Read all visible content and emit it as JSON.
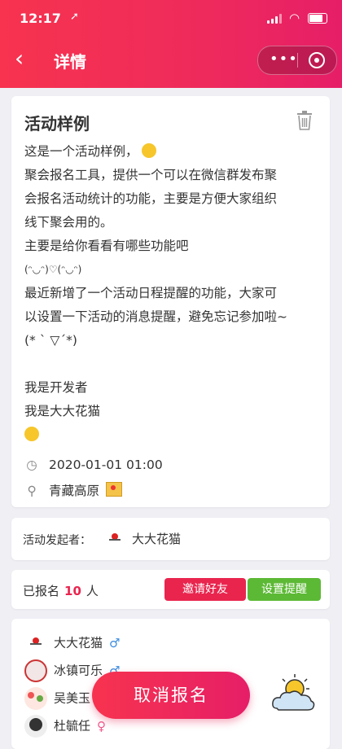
{
  "status": {
    "time": "12:17",
    "location_glyph": "➚"
  },
  "nav": {
    "back_glyph": "‹",
    "title": "详情",
    "more_glyph": "•••"
  },
  "activity": {
    "title": "活动样例",
    "description_lines": [
      "这是一个活动样例，",
      "聚会报名工具，提供一个可以在微信群发布聚",
      "会报名活动统计的功能，主要是方便大家组织",
      "线下聚会用的。",
      "主要是给你看看有哪些功能吧",
      "(ᵔ◡ᵔ)♡(ᵔ◡ᵔ)",
      "最近新增了一个活动日程提醒的功能，大家可",
      "以设置一下活动的消息提醒，避免忘记参加啦~",
      "(* ` ▽´*)",
      "",
      "我是开发者",
      "我是大大花猫",
      ""
    ],
    "datetime": "2020-01-01 01:00",
    "location": "青藏高原"
  },
  "organizer": {
    "label": "活动发起者：",
    "name": "大大花猫"
  },
  "signup": {
    "prefix": "已报名",
    "count": "10",
    "suffix": "人",
    "invite_label": "邀请好友",
    "remind_label": "设置提醒"
  },
  "members": [
    {
      "name": "大大花猫",
      "gender": "♂"
    },
    {
      "name": "冰镇可乐",
      "gender": "♂"
    },
    {
      "name": "吴美玉",
      "gender": "♀"
    },
    {
      "name": "杜毓任",
      "gender": "♀"
    }
  ],
  "cancel_label": "取消报名",
  "colors": {
    "primary": "#ee2a5c",
    "green": "#5cb935",
    "male": "#3b8de0",
    "female": "#f05a8d"
  }
}
